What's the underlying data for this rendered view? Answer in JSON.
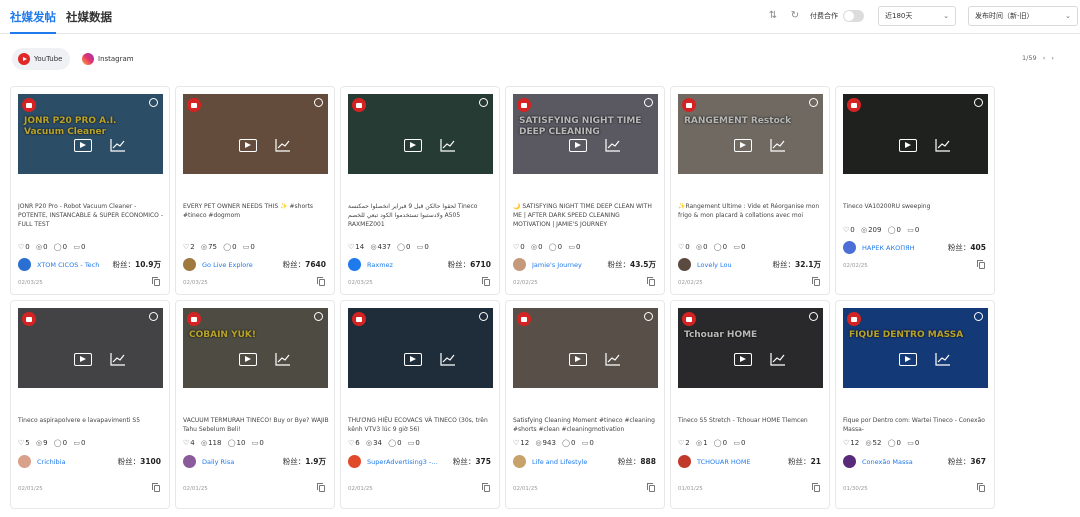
{
  "header": {
    "tab_posts": "社媒发帖",
    "tab_data": "社媒数据",
    "collab_label": "付费合作",
    "range_select": "近180天",
    "sort_select": "发布时间（新-旧）"
  },
  "platforms": [
    {
      "label": "YouTube",
      "active": true
    },
    {
      "label": "Instagram",
      "active": false
    }
  ],
  "pager": {
    "text": "1/59"
  },
  "fans_label": "粉丝：",
  "cards": [
    {
      "title": "JONR P20 Pro - Robot Vacuum Cleaner - POTENTE, INSTANCABLE & SUPER ECONOMICO - FULL TEST",
      "likes": "0",
      "views": "0",
      "comments": "0",
      "shares": "0",
      "author": "XTOM CICOS - Tech",
      "fans": "10.9万",
      "date": "02/03/25",
      "thumb_bg": "#3e6b8e",
      "avatar_color": "#2a6fd1"
    },
    {
      "title": "EVERY PET OWNER NEEDS THIS ✨ #shorts #tineco #dogmom",
      "likes": "2",
      "views": "75",
      "comments": "0",
      "shares": "0",
      "author": "Go Live Explore",
      "fans": "7640",
      "date": "02/03/25",
      "thumb_bg": "#8a6a52",
      "avatar_color": "#a0793f"
    },
    {
      "title": "لحقوا حالكن قبل 9 فبراير انخصلوا حمكنسة Tineco ولادستبوا تستخدموا الكود تبعي للخصم A505 RAXMEZ001",
      "likes": "14",
      "views": "437",
      "comments": "0",
      "shares": "0",
      "author": "Raxmez",
      "fans": "6710",
      "date": "02/03/25",
      "thumb_bg": "#37534a",
      "avatar_color": "#1f7aec"
    },
    {
      "title": "🌙 SATISFYING NIGHT TIME DEEP CLEAN WITH ME | AFTER DARK SPEED CLEANING MOTIVATION | JAMIE'S JOURNEY",
      "likes": "0",
      "views": "0",
      "comments": "0",
      "shares": "0",
      "author": "Jamie's Journey",
      "fans": "43.5万",
      "date": "02/02/25",
      "thumb_bg": "#7d7a86",
      "avatar_color": "#c49a7a"
    },
    {
      "title": "✨Rangement Ultime : Vide et Réorganise mon frigo & mon placard à collations avec moi",
      "likes": "0",
      "views": "0",
      "comments": "0",
      "shares": "0",
      "author": "Lovely Lou",
      "fans": "32.1万",
      "date": "02/02/25",
      "thumb_bg": "#9a9288",
      "avatar_color": "#5b4a3f"
    },
    {
      "title": "Tineco VA10200RU sweeping",
      "likes": "0",
      "views": "209",
      "comments": "0",
      "shares": "0",
      "author": "НАРЕК АКОПЯН",
      "fans": "405",
      "date": "02/02/25",
      "thumb_bg": "#2b2f2c",
      "avatar_color": "#4b6fd6"
    },
    {
      "title": "Tineco aspirapolvere e lavapavimenti S5",
      "likes": "5",
      "views": "9",
      "comments": "0",
      "shares": "0",
      "author": "Crichibia",
      "fans": "3100",
      "date": "02/01/25",
      "thumb_bg": "#5e5e62",
      "avatar_color": "#d9a08a"
    },
    {
      "title": "VACUUM TERMURAH TINECO! Buy or Bye? WAJIB Tahu Sebelum Beli!",
      "likes": "4",
      "views": "118",
      "comments": "10",
      "shares": "0",
      "author": "Daily Risa",
      "fans": "1.9万",
      "date": "02/01/25",
      "thumb_bg": "#6c6a5c",
      "avatar_color": "#8a5a9a"
    },
    {
      "title": "THƯƠNG HIỆU ECOVACS VÀ TINECO (30s, trên kênh VTV3 lúc 9 giờ 56)",
      "likes": "6",
      "views": "34",
      "comments": "0",
      "shares": "0",
      "author": "SuperAdvertising3 - Qu...",
      "fans": "375",
      "date": "02/01/25",
      "thumb_bg": "#2c3e50",
      "avatar_color": "#e04a2a"
    },
    {
      "title": "Satisfying Cleaning Moment #tineco #cleaning #shorts #clean #cleaningmotivation",
      "likes": "12",
      "views": "943",
      "comments": "0",
      "shares": "0",
      "author": "Life and Lifestyle",
      "fans": "888",
      "date": "02/01/25",
      "thumb_bg": "#7a7064",
      "avatar_color": "#c7a26a"
    },
    {
      "title": "Tineco S5 Stretch - Tchouar HOME Tlemcen",
      "likes": "2",
      "views": "1",
      "comments": "0",
      "shares": "0",
      "author": "TCHOUAR HOME",
      "fans": "21",
      "date": "01/01/25",
      "thumb_bg": "#3a3a3c",
      "avatar_color": "#c0392b"
    },
    {
      "title": "Fique por Dentro com: Wartei Tineco - Conexão Massa-",
      "likes": "12",
      "views": "52",
      "comments": "0",
      "shares": "0",
      "author": "Conexão Massa",
      "fans": "367",
      "date": "01/30/25",
      "thumb_bg": "#1d4fa6",
      "avatar_color": "#5a2a7a"
    }
  ],
  "thumb_overlays": [
    {
      "text": "JONR P20 PRO  A.I.  Vacuum  Cleaner",
      "color": "#ffe13a"
    },
    {
      "text": "",
      "color": "#ffffff"
    },
    {
      "text": "",
      "color": "#ffffff"
    },
    {
      "text": "SATISFYING NIGHT TIME DEEP CLEANING",
      "color": "#ffffff"
    },
    {
      "text": "RANGEMENT Restock",
      "color": "#ffffff"
    },
    {
      "text": "",
      "color": "#ffffff"
    },
    {
      "text": "",
      "color": "#ffffff"
    },
    {
      "text": "COBAIN YUK!",
      "color": "#ffe13a"
    },
    {
      "text": "",
      "color": "#ffffff"
    },
    {
      "text": "",
      "color": "#ffffff"
    },
    {
      "text": "Tchouar HOME",
      "color": "#ffffff"
    },
    {
      "text": "FIQUE DENTRO  MASSA",
      "color": "#ffe13a"
    }
  ]
}
